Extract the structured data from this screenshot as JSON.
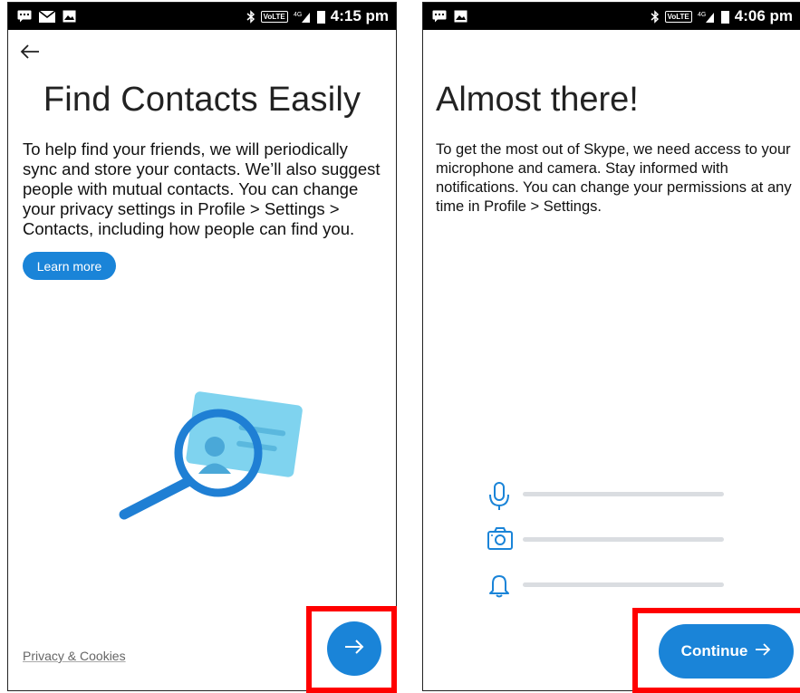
{
  "left_screen": {
    "status": {
      "time": "4:15 pm",
      "network": "4G",
      "volte": "VoLTE"
    },
    "title": "Find Contacts Easily",
    "body": "To help find your friends, we will periodically sync and store your contacts. We’ll also suggest people with mutual contacts. You can change your privacy settings in Profile > Settings > Contacts, including how people can find you.",
    "learn_more_label": "Learn more",
    "privacy_link": "Privacy & Cookies",
    "next_icon": "arrow-right-icon"
  },
  "right_screen": {
    "status": {
      "time": "4:06 pm",
      "network": "4G",
      "volte": "VoLTE"
    },
    "title": "Almost there!",
    "body": "To get the most out of Skype, we need access to your microphone and camera. Stay informed with notifications. You can change your permissions at any time in Profile > Settings.",
    "permissions": [
      {
        "icon": "microphone-icon"
      },
      {
        "icon": "camera-icon"
      },
      {
        "icon": "bell-icon"
      }
    ],
    "continue_label": "Continue"
  },
  "colors": {
    "accent": "#1a84d8",
    "highlight": "#ff0000",
    "statusbar": "#000000"
  }
}
